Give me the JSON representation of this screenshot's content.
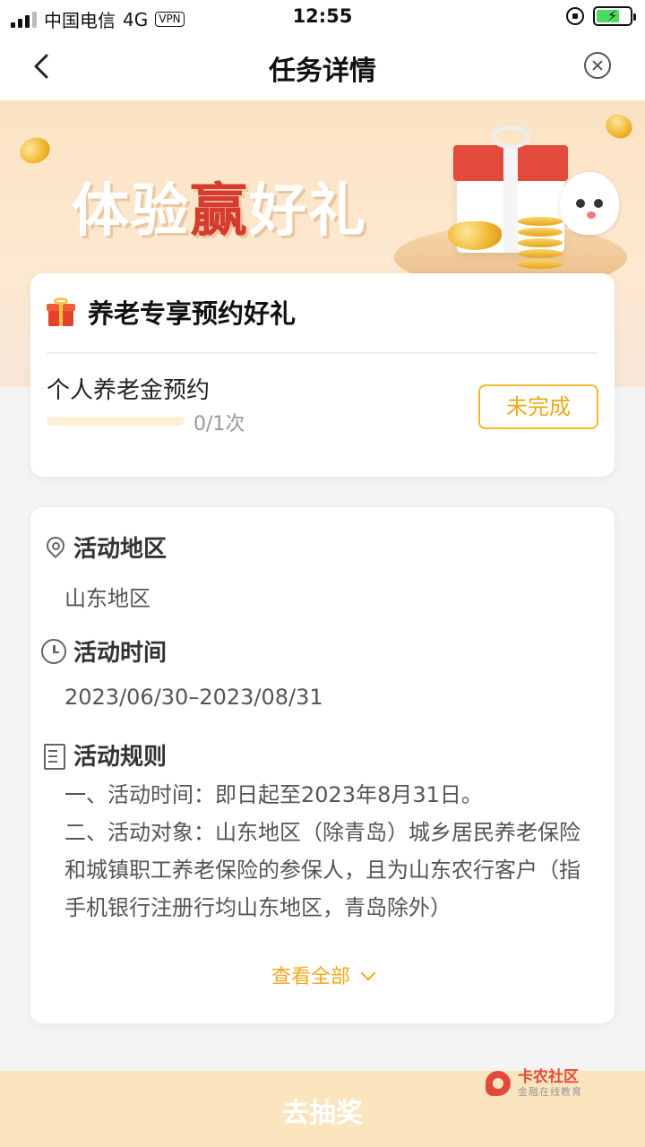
{
  "status_bar": {
    "carrier": "中国电信",
    "network": "4G",
    "vpn": "VPN",
    "time": "12:55"
  },
  "nav": {
    "title": "任务详情"
  },
  "banner": {
    "title_part1": "体验",
    "title_accent": "赢",
    "title_part2": "好礼"
  },
  "task_card": {
    "title": "养老专享预约好礼",
    "task_name": "个人养老金预约",
    "progress_text": "0/1次",
    "progress_fraction": 0,
    "status_button": "未完成"
  },
  "info": {
    "region_label": "活动地区",
    "region_value": "山东地区",
    "time_label": "活动时间",
    "time_value": "2023/06/30–2023/08/31",
    "rules_label": "活动规则",
    "rules_line1": "一、活动时间：即日起至2023年8月31日。",
    "rules_line2": "二、活动对象：山东地区（除青岛）城乡居民养老保险和城镇职工养老保险的参保人，且为山东农行客户（指手机银行注册行均山东地区，青岛除外）",
    "view_all": "查看全部"
  },
  "bottom": {
    "action_label": "去抽奖"
  },
  "watermark": {
    "name": "卡农社区",
    "tagline": "金融在线教育"
  },
  "colors": {
    "accent": "#f2a81a",
    "brand_red": "#d63b2d",
    "bottom_bg": "#fbe5bf"
  }
}
